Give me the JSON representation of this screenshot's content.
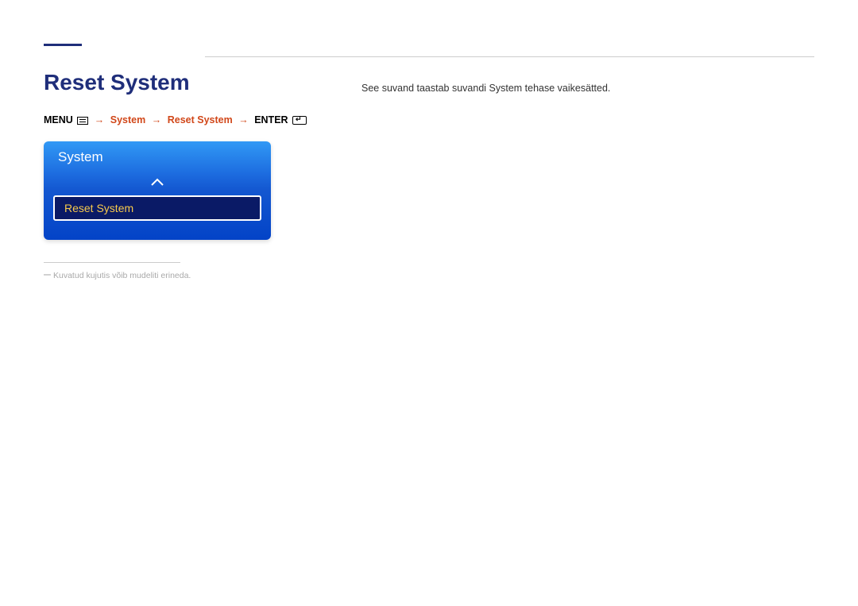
{
  "title": "Reset System",
  "breadcrumb": {
    "menu": "MENU",
    "path": [
      "System",
      "Reset System"
    ],
    "enter": "ENTER"
  },
  "panel": {
    "header": "System",
    "selected_item": "Reset System"
  },
  "footnote": "Kuvatud kujutis võib mudeliti erineda.",
  "description": "See suvand taastab suvandi System tehase vaikesätted."
}
